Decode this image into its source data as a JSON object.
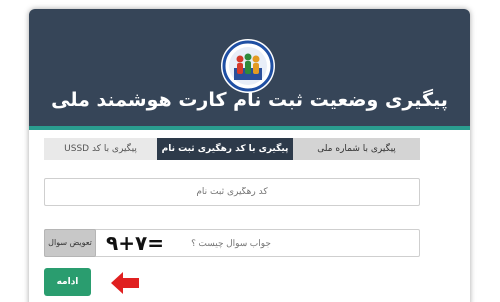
{
  "header": {
    "title": "پیگیری وضعیت ثبت نام کارت هوشمند ملی",
    "logo_icon": "national-registration-logo",
    "bg_color": "#364558",
    "accent_color": "#2a9d8f"
  },
  "tabs": [
    {
      "label": "پیگیری با کد USSD",
      "active": false
    },
    {
      "label": "پیگیری با کد رهگیری ثبت نام",
      "active": true
    },
    {
      "label": "پیگیری با شماره ملی",
      "active": false
    }
  ],
  "tracking_field": {
    "placeholder": "کد رهگیری ثبت نام",
    "value": ""
  },
  "captcha": {
    "switch_label": "تعویض سوال",
    "image_text": "۹+۷=",
    "answer_placeholder": "جواب سوال چیست ؟",
    "answer_value": ""
  },
  "actions": {
    "continue_label": "ادامه",
    "continue_color": "#2a9d6f",
    "pointer_icon": "red-arrow-icon",
    "pointer_color": "#e02020"
  }
}
